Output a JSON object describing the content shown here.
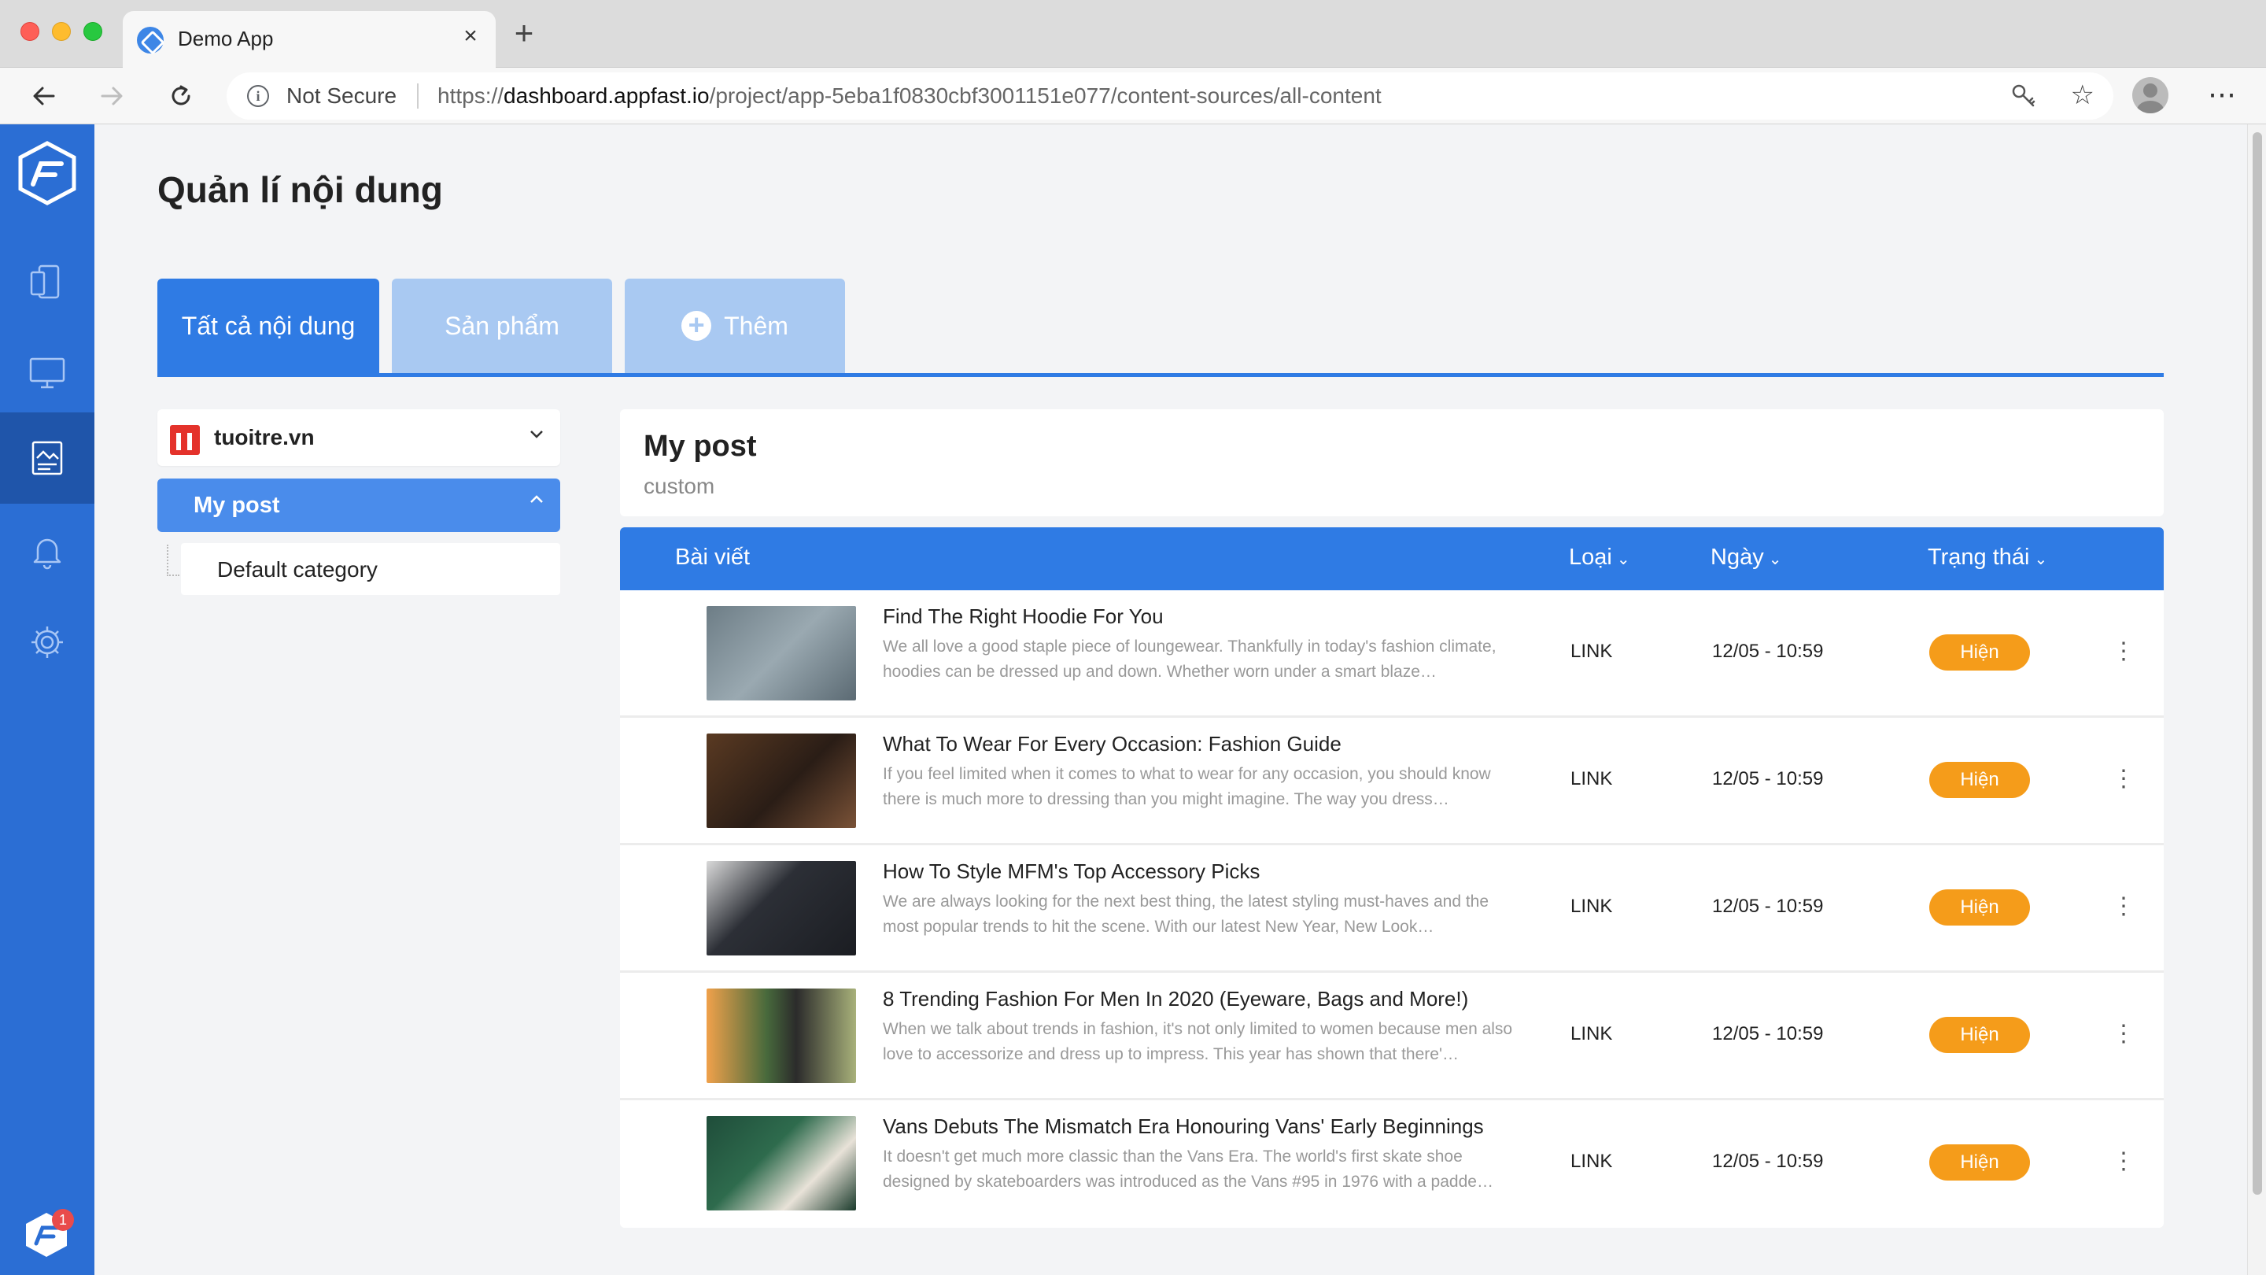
{
  "browser": {
    "tab_title": "Demo App",
    "tab_close": "×",
    "new_tab": "+",
    "not_secure": "Not Secure",
    "url_scheme": "https://",
    "url_host": "dashboard.appfast.io",
    "url_path": "/project/app-5eba1f0830cbf3001151e077/content-sources/all-content"
  },
  "sidebar": {
    "items": [
      {
        "icon": "devices-icon"
      },
      {
        "icon": "monitor-icon"
      },
      {
        "icon": "content-icon",
        "active": true
      },
      {
        "icon": "bell-icon"
      },
      {
        "icon": "gear-icon"
      }
    ],
    "badge_count": "1"
  },
  "page": {
    "title": "Quản lí nội dung",
    "tabs": [
      {
        "label": "Tất cả nội dung",
        "active": true
      },
      {
        "label": "Sản phẩm",
        "active": false
      },
      {
        "label": "Thêm",
        "active": false,
        "icon": "plus-circle-icon"
      }
    ]
  },
  "source": {
    "name": "tuoitre.vn",
    "categories": [
      {
        "label": "My post",
        "active": true
      },
      {
        "label": "Default category",
        "active": false
      }
    ]
  },
  "post_header": {
    "title": "My post",
    "subtitle": "custom"
  },
  "table": {
    "columns": {
      "post": "Bài viết",
      "type": "Loại",
      "date": "Ngày",
      "status": "Trạng thái"
    },
    "rows": [
      {
        "title": "Find The Right Hoodie For You",
        "desc": "We all love a good staple piece of loungewear. Thankfully in today's fashion climate, hoodies can be dressed up and down. Whether worn under a smart blaze…",
        "type": "LINK",
        "date": "12/05 - 10:59",
        "status": "Hiện"
      },
      {
        "title": "What To Wear For Every Occasion: Fashion Guide",
        "desc": "If you feel limited when it comes to what to wear for any occasion, you should know there is much more to dressing than you might imagine. The way you dress…",
        "type": "LINK",
        "date": "12/05 - 10:59",
        "status": "Hiện"
      },
      {
        "title": "How To Style MFM's Top Accessory Picks",
        "desc": "We are always looking for the next best thing, the latest styling must-haves and the most popular trends to hit the scene. With our latest New Year, New Look…",
        "type": "LINK",
        "date": "12/05 - 10:59",
        "status": "Hiện"
      },
      {
        "title": "8 Trending Fashion For Men In 2020 (Eyeware, Bags and More!)",
        "desc": "When we talk about trends in fashion, it's not only limited to women because men also love to accessorize and dress up to impress. This year has shown that there'…",
        "type": "LINK",
        "date": "12/05 - 10:59",
        "status": "Hiện"
      },
      {
        "title": "Vans Debuts The Mismatch Era Honouring Vans' Early Beginnings",
        "desc": "It doesn't get much more classic than the Vans Era. The world's first skate shoe designed by skateboarders was introduced as the Vans #95 in 1976 with a padde…",
        "type": "LINK",
        "date": "12/05 - 10:59",
        "status": "Hiện"
      }
    ]
  },
  "colors": {
    "primary": "#2f7be4",
    "sidebar": "#2b6ed4",
    "status_visible": "#f59c1a"
  }
}
